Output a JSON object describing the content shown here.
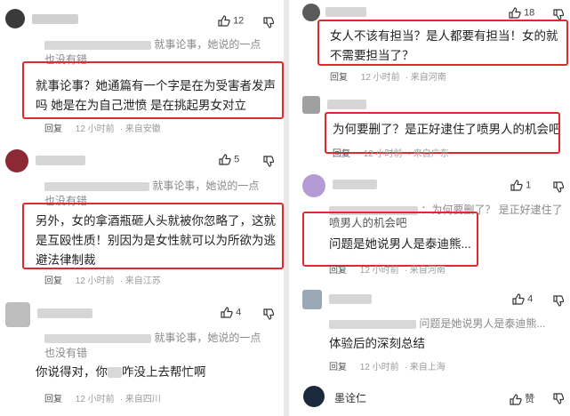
{
  "left": {
    "comment1": {
      "likes": "12",
      "quote_line1": "就事论事，她说的一点",
      "quote_line2": "也没有错",
      "text": "就事论事？她通篇有一个字是在为受害者发声吗 她是在为自己泄愤 是在挑起男女对立",
      "reply": "回复",
      "time": "12 小时前",
      "location": "来自安徽"
    },
    "comment2": {
      "likes": "5",
      "quote_line1": "就事论事，她说的一点",
      "quote_line2": "也没有错",
      "text": "另外，女的拿酒瓶砸人头就被你忽略了，这就是互殴性质！别因为是女性就可以为所欲为逃避法律制裁",
      "reply": "回复",
      "time": "12 小时前",
      "location": "来自江苏"
    },
    "comment3": {
      "likes": "4",
      "quote_line1": "就事论事，她说的一点",
      "quote_line2": "也没有错",
      "text_a": "你说得对，你",
      "text_b": "咋没上去帮忙啊",
      "reply": "回复",
      "time": "12 小时前",
      "location": "来自四川"
    }
  },
  "right": {
    "comment1": {
      "likes": "18",
      "text": "女人不该有担当？是人都要有担当！女的就不需要担当了？",
      "reply": "回复",
      "time": "12 小时前",
      "location": "来自河南"
    },
    "comment2": {
      "text": "为何要删了？是正好逮住了喷男人的机会吧",
      "reply": "回复",
      "time": "12 小时前",
      "location": "来自广东"
    },
    "comment3": {
      "likes": "1",
      "quote_line1": "：为何要删了？ 是正好逮住了",
      "quote_line2": "喷男人的机会吧",
      "text": "问题是她说男人是泰迪熊...",
      "reply": "回复",
      "time": "12 小时前",
      "location": "来自河南"
    },
    "comment4": {
      "likes": "4",
      "quote_line1": "问题是她说男人是泰迪熊...",
      "text": "体验后的深刻总结",
      "reply": "回复",
      "time": "12 小时前",
      "location": "来自上海"
    },
    "comment5": {
      "username": "墨诠仁",
      "likes": "赞"
    }
  },
  "colors": {
    "highlight_box": "#e0282e",
    "meta_text": "#9a9a9a"
  },
  "icons": {
    "like": "thumbs-up-icon",
    "dislike": "thumbs-down-icon"
  }
}
